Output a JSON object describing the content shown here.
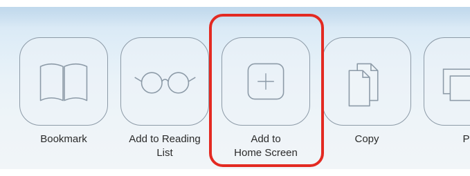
{
  "share_sheet": {
    "actions": [
      {
        "label": "Bookmark",
        "icon": "open-book-icon"
      },
      {
        "label": "Add to Reading\nList",
        "icon": "reading-glasses-icon"
      },
      {
        "label": "Add to\nHome Screen",
        "icon": "plus-in-square-icon"
      },
      {
        "label": "Copy",
        "icon": "copy-documents-icon"
      },
      {
        "label": "Pr",
        "icon": "print-icon"
      }
    ]
  },
  "colors": {
    "icon_stroke": "#8c9aa7",
    "highlight": "#e32a22"
  }
}
